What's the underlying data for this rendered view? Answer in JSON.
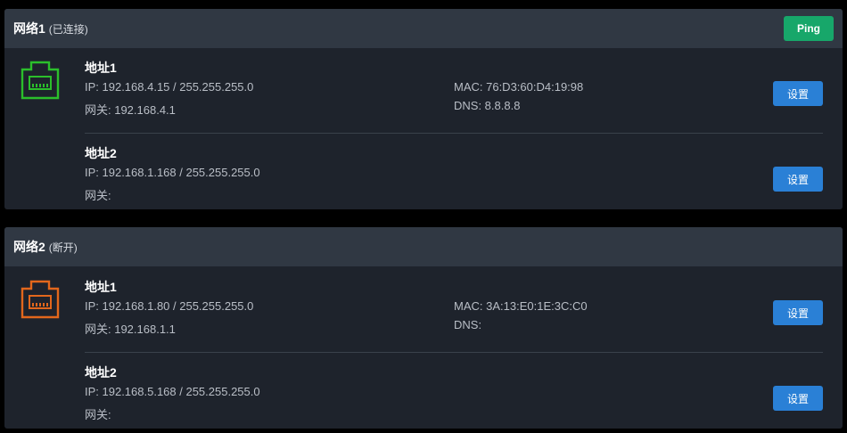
{
  "networks": [
    {
      "name": "网络1",
      "status": "(已连接)",
      "ping_label": "Ping",
      "icon_color": "#2bbf2b",
      "addresses": [
        {
          "title": "地址1",
          "ip": "IP: 192.168.4.15 / 255.255.255.0",
          "gateway": "网关: 192.168.4.1",
          "mac": "MAC: 76:D3:60:D4:19:98",
          "dns": "DNS: 8.8.8.8",
          "button": "设置"
        },
        {
          "title": "地址2",
          "ip": "IP: 192.168.1.168 / 255.255.255.0",
          "gateway": "网关:",
          "button": "设置"
        }
      ]
    },
    {
      "name": "网络2",
      "status": "(断开)",
      "icon_color": "#e2671c",
      "addresses": [
        {
          "title": "地址1",
          "ip": "IP: 192.168.1.80 / 255.255.255.0",
          "gateway": "网关: 192.168.1.1",
          "mac": "MAC: 3A:13:E0:1E:3C:C0",
          "dns": "DNS:",
          "button": "设置"
        },
        {
          "title": "地址2",
          "ip": "IP: 192.168.5.168 / 255.255.255.0",
          "gateway": "网关:",
          "button": "设置"
        }
      ]
    }
  ]
}
